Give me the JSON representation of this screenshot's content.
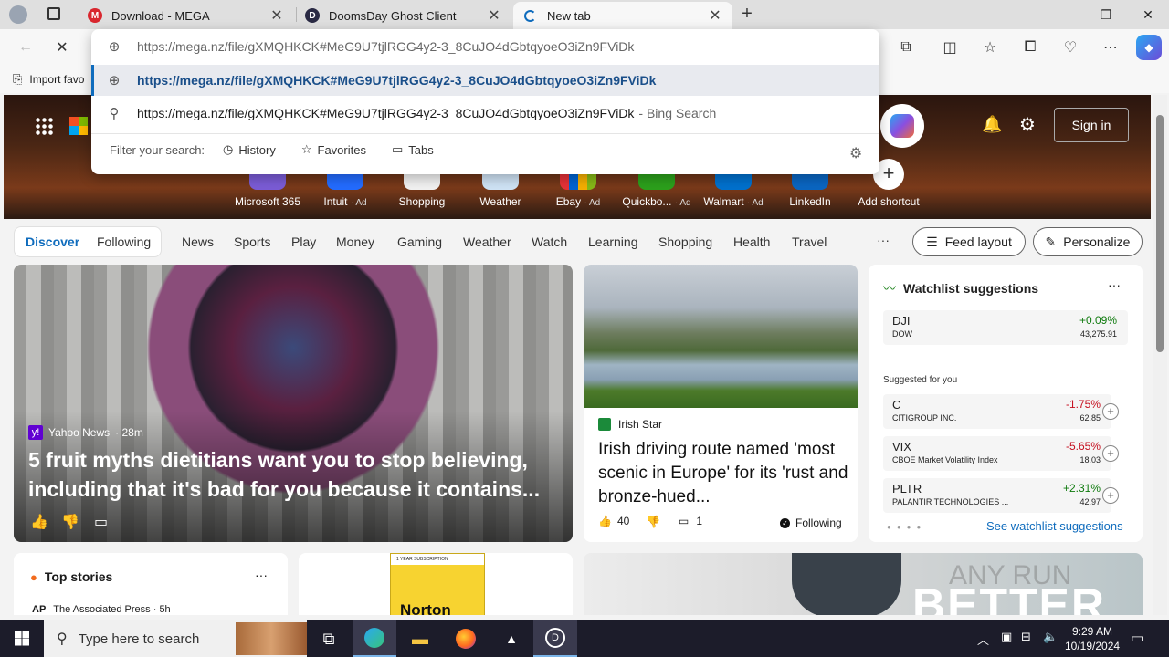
{
  "tabs": [
    {
      "title": "Download - MEGA",
      "icon": "mega-icon"
    },
    {
      "title": "DoomsDay Ghost Client",
      "icon": "doomsday-icon"
    },
    {
      "title": "New tab",
      "icon": "loading-icon"
    }
  ],
  "address": {
    "typed": "https://mega.nz/file/gXMQHKCK#MeG9U7tjlRGG4y2-3_8CuJO4dGbtqyoeO3iZn9FViDk",
    "suggestion_url": "https://mega.nz/file/gXMQHKCK#MeG9U7tjlRGG4y2-3_8CuJO4dGbtqyoeO3iZn9FViDk",
    "search_text": "https://mega.nz/file/gXMQHKCK#MeG9U7tjlRGG4y2-3_8CuJO4dGbtqyoeO3iZn9FViDk",
    "search_suffix": "- Bing Search",
    "filter_label": "Filter your search:",
    "filters": [
      "History",
      "Favorites",
      "Tabs"
    ]
  },
  "favorites_bar": {
    "import": "Import favo"
  },
  "hero": {
    "sign_in": "Sign in",
    "shortcuts": [
      {
        "label": "Microsoft 365",
        "ad": ""
      },
      {
        "label": "Intuit",
        "ad": "· Ad"
      },
      {
        "label": "Shopping",
        "ad": ""
      },
      {
        "label": "Weather",
        "ad": ""
      },
      {
        "label": "Ebay",
        "ad": "· Ad"
      },
      {
        "label": "Quickbo...",
        "ad": "· Ad"
      },
      {
        "label": "Walmart",
        "ad": "· Ad"
      },
      {
        "label": "LinkedIn",
        "ad": ""
      },
      {
        "label": "Add shortcut",
        "ad": ""
      }
    ]
  },
  "nav": {
    "discover": "Discover",
    "following": "Following",
    "items": [
      "News",
      "Sports",
      "Play",
      "Money",
      "Gaming",
      "Weather",
      "Watch",
      "Learning",
      "Shopping",
      "Health",
      "Travel"
    ],
    "more": "···",
    "feed_layout": "Feed layout",
    "personalize": "Personalize"
  },
  "main_card": {
    "source": "Yahoo News",
    "age": "· 28m",
    "headline": "5 fruit myths dietitians want you to stop believing, including that it's bad for you because it contains..."
  },
  "side_card": {
    "source": "Irish Star",
    "headline": "Irish driving route named 'most scenic in Europe' for its 'rust and bronze-hued...",
    "likes": "40",
    "comments": "1",
    "following": "Following"
  },
  "watchlist": {
    "title": "Watchlist suggestions",
    "suggested_label": "Suggested for you",
    "footer_link": "See watchlist suggestions",
    "top": {
      "symbol": "DJI",
      "name": "DOW",
      "change": "+0.09%",
      "price": "43,275.91",
      "color": "#0e7a0d"
    },
    "stocks": [
      {
        "symbol": "C",
        "name": "CITIGROUP INC.",
        "change": "-1.75%",
        "price": "62.85",
        "color": "#c50f1f"
      },
      {
        "symbol": "VIX",
        "name": "CBOE Market Volatility Index",
        "change": "-5.65%",
        "price": "18.03",
        "color": "#c50f1f"
      },
      {
        "symbol": "PLTR",
        "name": "PALANTIR TECHNOLOGIES ...",
        "change": "+2.31%",
        "price": "42.97",
        "color": "#0e7a0d"
      }
    ]
  },
  "top_stories": {
    "title": "Top stories",
    "source": "The Associated Press · 5h"
  },
  "ad_card": {
    "brand": "Norton",
    "small": "1 YEAR SUBSCRIPTION"
  },
  "video_card": {
    "overlay": "BETTER",
    "watermark": "ANY RUN"
  },
  "taskbar": {
    "search_placeholder": "Type here to search",
    "time": "9:29 AM",
    "date": "10/19/2024"
  }
}
